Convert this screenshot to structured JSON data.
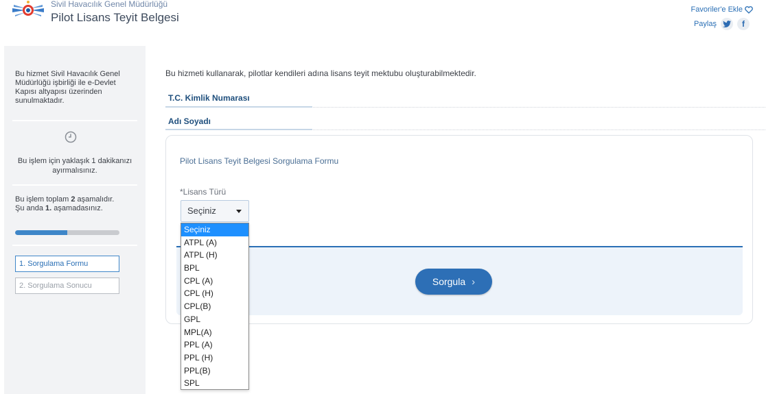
{
  "header": {
    "org_name": "Sivil Havacılık Genel Müdürlüğü",
    "title": "Pilot Lisans Teyit Belgesi",
    "favorites_label": "Favoriler'e Ekle",
    "share_label": "Paylaş"
  },
  "sidebar": {
    "info_text": "Bu hizmet Sivil Havacılık Genel Müdürlüğü işbirliği ile e-Devlet Kapısı altyapısı üzerinden sunulmaktadır.",
    "time_text": "Bu işlem için yaklaşık 1 dakikanızı ayırmalısınız.",
    "steps_text_prefix": "Bu işlem toplam ",
    "steps_total": "2",
    "steps_text_middle": " aşamalıdır.",
    "current_prefix": "Şu anda ",
    "current_step": "1.",
    "current_suffix": " aşamadasınız.",
    "progress": 0.5,
    "steps": [
      "1. Sorgulama Formu",
      "2. Sorgulama Sonucu"
    ]
  },
  "main": {
    "intro": "Bu hizmeti kullanarak, pilotlar kendileri adına lisans teyit mektubu oluşturabilmektedir.",
    "tc_label": "T.C. Kimlik Numarası",
    "name_label": "Adı Soyadı",
    "form_title": "Pilot Lisans Teyit Belgesi Sorgulama Formu",
    "license_label": "*Lisans Türü",
    "select_value": "Seçiniz",
    "submit_label": "Sorgula",
    "options": [
      "Seçiniz",
      "ATPL (A)",
      "ATPL (H)",
      "BPL",
      "CPL (A)",
      "CPL (H)",
      "CPL(B)",
      "GPL",
      "MPL(A)",
      "PPL (A)",
      "PPL (H)",
      "PPL(B)",
      "SPL"
    ]
  },
  "colors": {
    "accent": "#2d6fb6",
    "dropdown_highlight": "#1e90ff",
    "sidebar_bg": "#f2f3f5"
  }
}
